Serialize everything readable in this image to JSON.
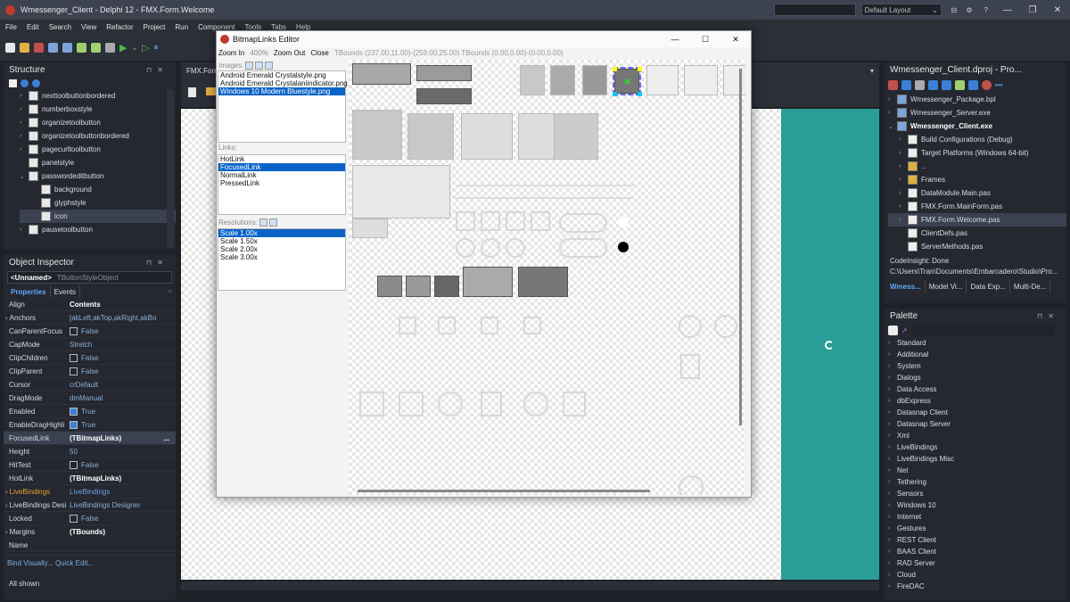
{
  "window": {
    "title": "Wmessenger_Client - Delphi 12 - FMX.Form.Welcome",
    "layout": "Default Layout"
  },
  "menu": [
    "File",
    "Edit",
    "Search",
    "View",
    "Refactor",
    "Project",
    "Run",
    "Component",
    "Tools",
    "Tabs",
    "Help"
  ],
  "structure": {
    "title": "Structure",
    "items": [
      {
        "label": "nexttoolbuttonbordered",
        "depth": 1,
        "chev": "›"
      },
      {
        "label": "numberboxstyle",
        "depth": 1,
        "chev": "›"
      },
      {
        "label": "organizetoolbutton",
        "depth": 1,
        "chev": "›"
      },
      {
        "label": "organizetoolbuttonbordered",
        "depth": 1,
        "chev": "›"
      },
      {
        "label": "pagecurltoolbutton",
        "depth": 1,
        "chev": "›"
      },
      {
        "label": "panelstyle",
        "depth": 1,
        "chev": ""
      },
      {
        "label": "passwordeditbutton",
        "depth": 1,
        "chev": "⌄"
      },
      {
        "label": "background",
        "depth": 2,
        "chev": ""
      },
      {
        "label": "glyphstyle",
        "depth": 2,
        "chev": ""
      },
      {
        "label": "icon",
        "depth": 2,
        "chev": "",
        "selected": true
      },
      {
        "label": "pausetoolbutton",
        "depth": 1,
        "chev": "›"
      }
    ]
  },
  "inspector": {
    "title": "Object Inspector",
    "object": "<Unnamed>",
    "object_type": "TButtonStyleObject",
    "tabs": [
      "Properties",
      "Events"
    ],
    "rows": [
      {
        "name": "Align",
        "value": "Contents",
        "bold": true
      },
      {
        "name": "Anchors",
        "value": "[akLeft,akTop,akRight,akBo",
        "chev": "›"
      },
      {
        "name": "CanParentFocus",
        "value": "False",
        "check": "off"
      },
      {
        "name": "CapMode",
        "value": "Stretch"
      },
      {
        "name": "ClipChildren",
        "value": "False",
        "check": "off"
      },
      {
        "name": "ClipParent",
        "value": "False",
        "check": "off"
      },
      {
        "name": "Cursor",
        "value": "crDefault"
      },
      {
        "name": "DragMode",
        "value": "dmManual"
      },
      {
        "name": "Enabled",
        "value": "True",
        "check": "on"
      },
      {
        "name": "EnableDragHighli",
        "value": "True",
        "check": "on"
      },
      {
        "name": "FocusedLink",
        "value": "(TBitmapLinks)",
        "bold": true,
        "selected": true,
        "dots": "..."
      },
      {
        "name": "Height",
        "value": "50"
      },
      {
        "name": "HitTest",
        "value": "False",
        "check": "off"
      },
      {
        "name": "HotLink",
        "value": "(TBitmapLinks)",
        "bold": true
      },
      {
        "name": "LiveBindings",
        "value": "LiveBindings",
        "chev": "›",
        "orange": true
      },
      {
        "name": "LiveBindings Desi",
        "value": "LiveBindings Designer",
        "chev": "›"
      },
      {
        "name": "Locked",
        "value": "False",
        "check": "off"
      },
      {
        "name": "Margins",
        "value": "(TBounds)",
        "bold": true,
        "chev": "›"
      },
      {
        "name": "Name",
        "value": ""
      }
    ],
    "footer_links": "Bind Visually... Quick Edit...",
    "status": "All shown"
  },
  "designer": {
    "tab": "FMX.Form"
  },
  "dialog": {
    "title": "BitmapLinks Editor",
    "zoom_in": "Zoom In",
    "zoom_value": "400%",
    "zoom_out": "Zoom Out",
    "close": "Close",
    "bounds": "TBounds (237.00,11.00)-(259.00,25.00) TBounds (0.00,0.00)-(0.00,0.00)",
    "images_label": "Images:",
    "images": [
      "Android Emerald Crystalstyle.png",
      "Android Emerald Crystalaniindicator.png",
      "Windows 10 Modern Bluestyle.png"
    ],
    "images_selected": 2,
    "links_label": "Links:",
    "links": [
      "HotLink",
      "FocusedLink",
      "NormalLink",
      "PressedLink"
    ],
    "links_selected": 1,
    "res_label": "Resolutions:",
    "resolutions": [
      "Scale 1.00x",
      "Scale 1.50x",
      "Scale 2.00x",
      "Scale 3.00x"
    ],
    "res_selected": 0
  },
  "project": {
    "title": "Wmessenger_Client.dproj - Pro...",
    "items": [
      {
        "label": "Wmessenger_Package.bpl",
        "depth": 0,
        "chev": "›"
      },
      {
        "label": "Wmessenger_Server.exe",
        "depth": 0,
        "chev": "›"
      },
      {
        "label": "Wmessenger_Client.exe",
        "depth": 0,
        "chev": "⌄",
        "bold": true
      },
      {
        "label": "Build Configurations (Debug)",
        "depth": 1,
        "chev": "›"
      },
      {
        "label": "Target Platforms (Windows 64-bit)",
        "depth": 1,
        "chev": "›"
      },
      {
        "label": "..",
        "depth": 1,
        "chev": "›"
      },
      {
        "label": "Frames",
        "depth": 1,
        "chev": "›"
      },
      {
        "label": "DataModule.Main.pas",
        "depth": 1,
        "chev": "›"
      },
      {
        "label": "FMX.Form.MainForm.pas",
        "depth": 1,
        "chev": "›"
      },
      {
        "label": "FMX.Form.Welcome.pas",
        "depth": 1,
        "chev": "›",
        "selected": true
      },
      {
        "label": "ClientDefs.pas",
        "depth": 1,
        "chev": ""
      },
      {
        "label": "ServerMethods.pas",
        "depth": 1,
        "chev": ""
      }
    ],
    "codeinsight": "CodeInsight: Done",
    "path": "C:\\Users\\Tran\\Documents\\Embarcadero\\Studio\\Pro...",
    "tabs": [
      "Wmess...",
      "Model Vi...",
      "Data Exp...",
      "Multi-De..."
    ]
  },
  "palette": {
    "title": "Palette",
    "items": [
      "Standard",
      "Additional",
      "System",
      "Dialogs",
      "Data Access",
      "dbExpress",
      "Datasnap Client",
      "Datasnap Server",
      "Xml",
      "LiveBindings",
      "LiveBindings Misc",
      "Net",
      "Tethering",
      "Sensors",
      "Windows 10",
      "Internet",
      "Gestures",
      "REST Client",
      "BAAS Client",
      "RAD Server",
      "Cloud",
      "FireDAC"
    ]
  },
  "colors": {
    "accent": "#0a64c8",
    "teal": "#2a9d96",
    "ide_bg": "#252830"
  }
}
